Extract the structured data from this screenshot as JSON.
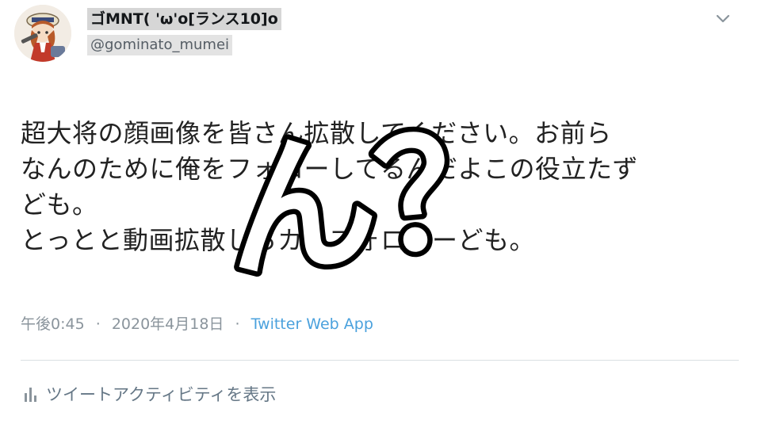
{
  "author": {
    "display_name": "ゴMNT( 'ω'o[ランス10]o",
    "handle": "@gominato_mumei",
    "avatar_icon": "avatar-anime-character"
  },
  "menu": {
    "icon": "chevron-down-icon"
  },
  "tweet": {
    "text": "超大将の顔画像を皆さん拡散してください。お前ら\nなんのために俺をフォローしてるんだよこの役立たず\nども。\nとっとと動画拡散しろカスフォロワーども。"
  },
  "meta": {
    "time": "午後0:45",
    "separator": "·",
    "date": "2020年4月18日",
    "source": "Twitter Web App"
  },
  "activity": {
    "label": "ツイートアクティビティを表示",
    "icon": "bar-chart-icon"
  },
  "overlay": {
    "text": "ん？"
  },
  "colors": {
    "link": "#4aa1dd",
    "muted": "#8a949c",
    "name_highlight": "#d6d6d6",
    "handle_highlight": "#e3e3e3"
  }
}
